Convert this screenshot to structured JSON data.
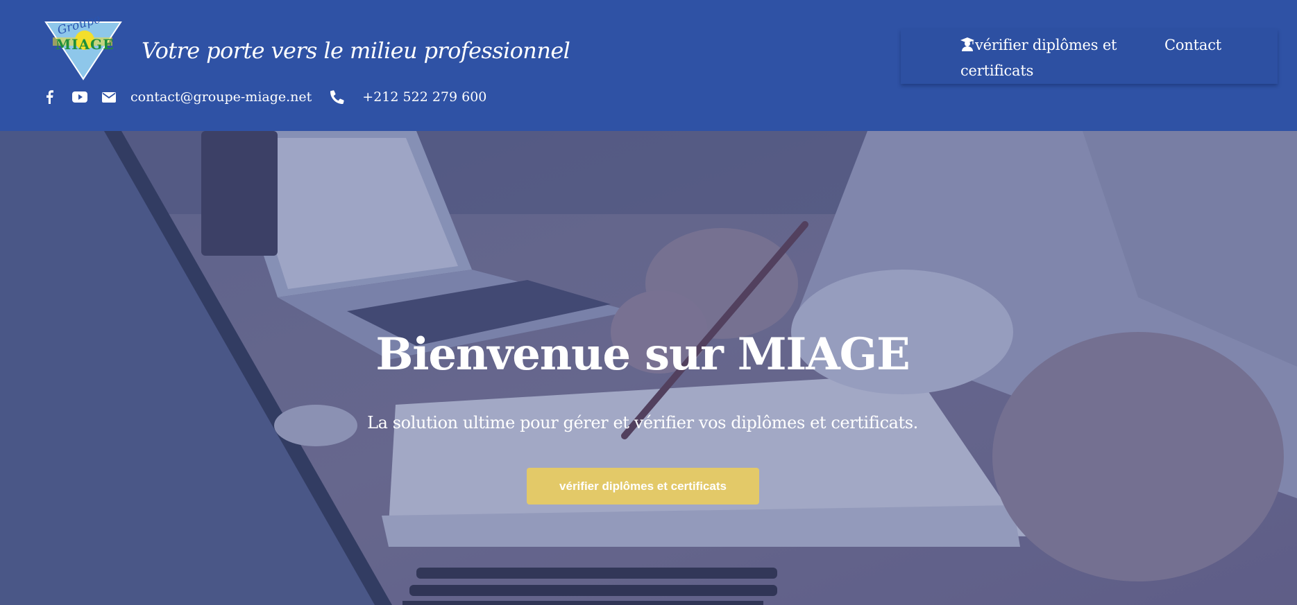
{
  "header": {
    "logo": {
      "name": "groupe-miage-logo",
      "text_top": "Groupe",
      "text_main": "MIAGE"
    },
    "tagline": "Votre porte vers le milieu professionnel",
    "social": [
      {
        "icon": "facebook-icon"
      },
      {
        "icon": "youtube-icon"
      },
      {
        "icon": "envelope-icon"
      }
    ],
    "email": "contact@groupe-miage.net",
    "phone_icon": "phone-icon",
    "phone": "+212 522 279 600"
  },
  "nav": {
    "verify_icon": "graduate-icon",
    "verify_label": "vérifier diplômes et certificats",
    "contact_label": "Contact"
  },
  "hero": {
    "title": "Bienvenue sur MIAGE",
    "subtitle": "La solution ultime pour gérer et vérifier vos diplômes et certificats.",
    "cta_label": "vérifier diplômes et certificats"
  },
  "colors": {
    "header_bg": "#2f52a5",
    "button_bg": "#e3c968",
    "text": "#ffffff"
  }
}
